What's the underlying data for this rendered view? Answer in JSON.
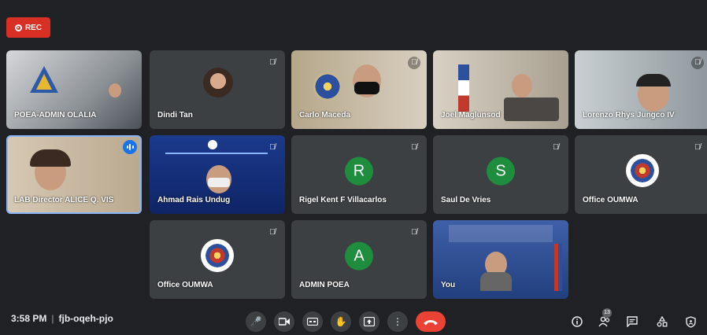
{
  "recording": {
    "label": "REC"
  },
  "tiles": [
    {
      "name": "POEA-ADMIN OLALIA"
    },
    {
      "name": "Dindi Tan"
    },
    {
      "name": "Carlo Maceda"
    },
    {
      "name": "Joel Maglunsod"
    },
    {
      "name": "Lorenzo Rhys Jungco IV"
    },
    {
      "name": "LAB Director ALICE Q. VIS"
    },
    {
      "name": "Ahmad Rais Undug"
    },
    {
      "name": "Rigel Kent F Villacarlos",
      "initial": "R",
      "color": "#1e8e3e"
    },
    {
      "name": "Saul De Vries",
      "initial": "S",
      "color": "#1e8e3e"
    },
    {
      "name": "Office OUMWA"
    },
    {
      "name": "Office OUMWA"
    },
    {
      "name": "ADMIN POEA",
      "initial": "A",
      "color": "#1e8e3e"
    },
    {
      "name": "You"
    }
  ],
  "meeting": {
    "time": "3:58 PM",
    "code": "fjb-oqeh-pjo"
  },
  "people_count": "13",
  "colors": {
    "end_call": "#ea4335",
    "rec": "#d93025",
    "speaking": "#1a73e8",
    "tile": "#3c4043",
    "background": "#202124"
  },
  "icons": [
    "record-icon",
    "mic-off-icon",
    "mic-icon",
    "camera-icon",
    "captions-icon",
    "raise-hand-icon",
    "present-icon",
    "more-options-icon",
    "end-call-icon",
    "info-icon",
    "people-icon",
    "chat-icon",
    "activities-icon",
    "host-controls-icon"
  ]
}
